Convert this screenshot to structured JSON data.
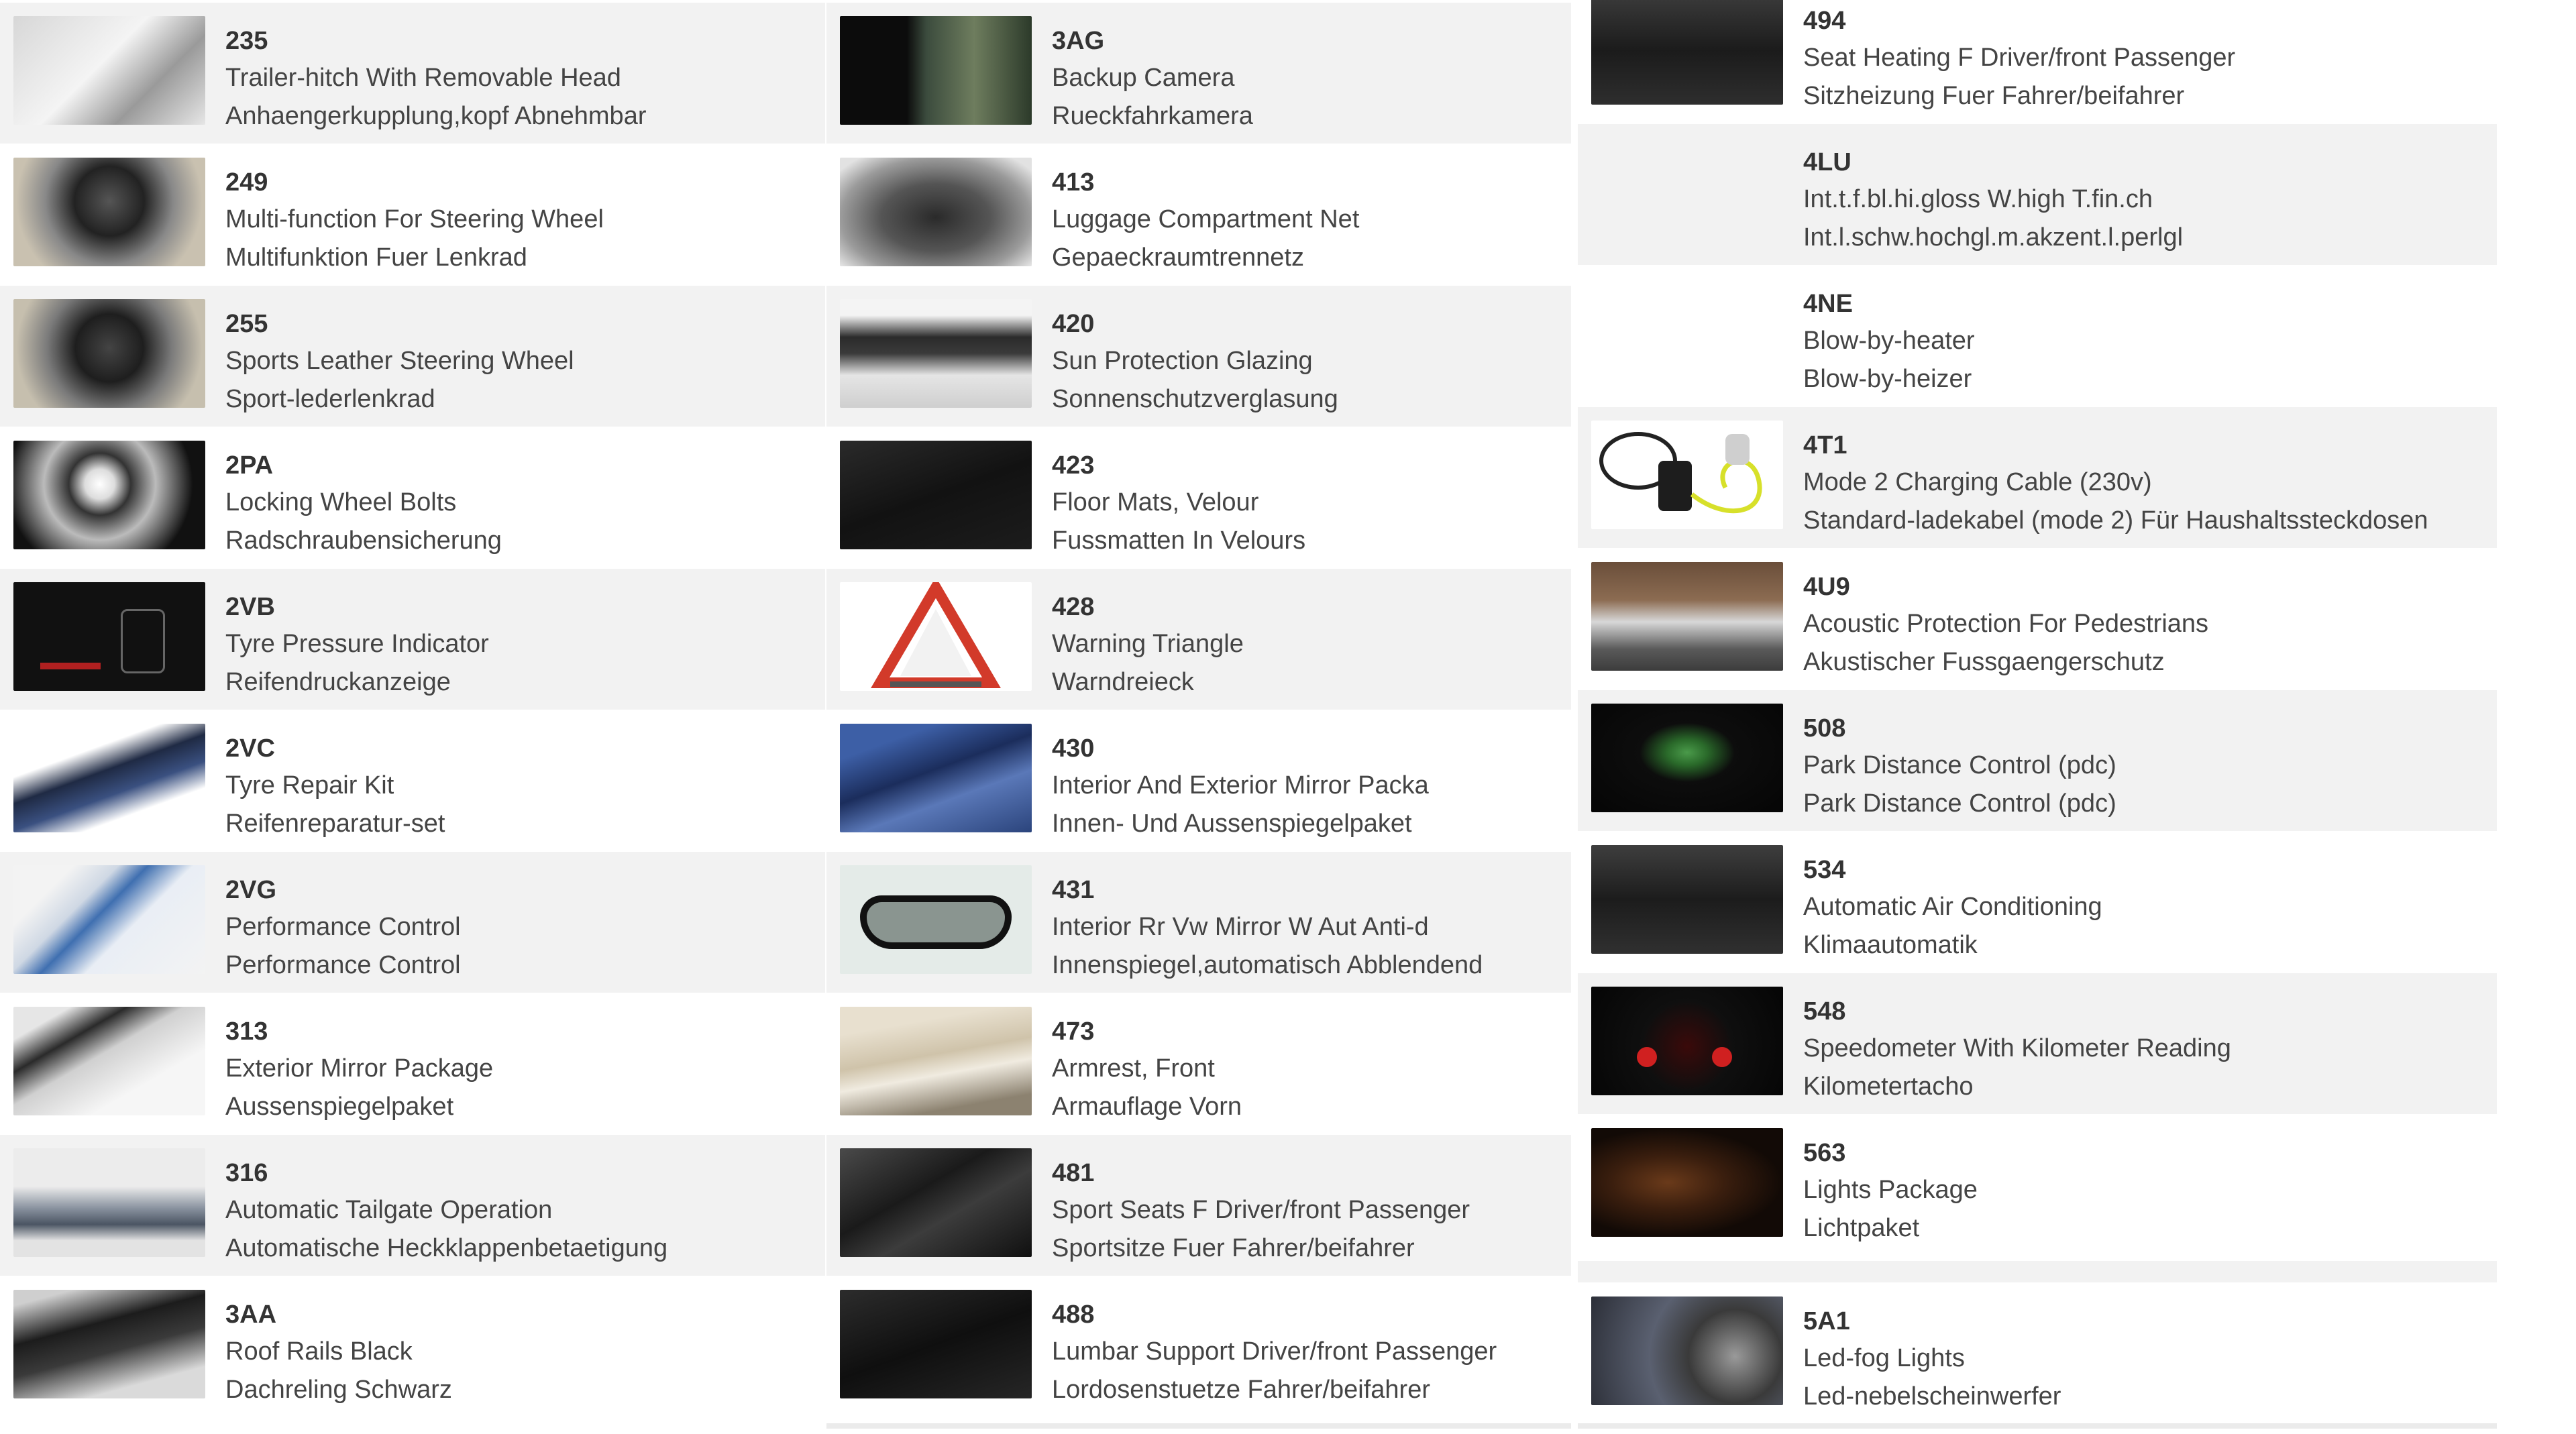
{
  "columns": [
    {
      "items": [
        {
          "code": "235",
          "name_en": "Trailer-hitch With Removable Head",
          "name_de": "Anhaengerkupplung,kopf Abnehmbar",
          "icon": "trailer-hitch-photo"
        },
        {
          "code": "249",
          "name_en": "Multi-function For Steering Wheel",
          "name_de": "Multifunktion Fuer Lenkrad",
          "icon": "steering-wheel-photo"
        },
        {
          "code": "255",
          "name_en": "Sports Leather Steering Wheel",
          "name_de": "Sport-lederlenkrad",
          "icon": "sport-steering-wheel-photo"
        },
        {
          "code": "2PA",
          "name_en": "Locking Wheel Bolts",
          "name_de": "Radschraubensicherung",
          "icon": "wheel-bolts-photo"
        },
        {
          "code": "2VB",
          "name_en": "Tyre Pressure Indicator",
          "name_de": "Reifendruckanzeige",
          "icon": "tyre-pressure-screen-photo"
        },
        {
          "code": "2VC",
          "name_en": "Tyre Repair Kit",
          "name_de": "Reifenreparatur-set",
          "icon": "tyre-repair-kit-photo"
        },
        {
          "code": "2VG",
          "name_en": "Performance Control",
          "name_de": "Performance Control",
          "icon": "performance-control-photo"
        },
        {
          "code": "313",
          "name_en": "Exterior Mirror Package",
          "name_de": "Aussenspiegelpaket",
          "icon": "exterior-mirror-photo"
        },
        {
          "code": "316",
          "name_en": "Automatic Tailgate Operation",
          "name_de": "Automatische Heckklappenbetaetigung",
          "icon": "tailgate-photo"
        },
        {
          "code": "3AA",
          "name_en": "Roof Rails Black",
          "name_de": "Dachreling Schwarz",
          "icon": "roof-rails-photo"
        }
      ]
    },
    {
      "items": [
        {
          "code": "3AG",
          "name_en": "Backup Camera",
          "name_de": "Rueckfahrkamera",
          "icon": "backup-camera-screen-photo"
        },
        {
          "code": "413",
          "name_en": "Luggage Compartment Net",
          "name_de": "Gepaeckraumtrennetz",
          "icon": "luggage-net-photo"
        },
        {
          "code": "420",
          "name_en": "Sun Protection Glazing",
          "name_de": "Sonnenschutzverglasung",
          "icon": "sun-protection-glazing-photo"
        },
        {
          "code": "423",
          "name_en": "Floor Mats, Velour",
          "name_de": "Fussmatten In Velours",
          "icon": "floor-mats-photo"
        },
        {
          "code": "428",
          "name_en": "Warning Triangle",
          "name_de": "Warndreieck",
          "icon": "warning-triangle-photo"
        },
        {
          "code": "430",
          "name_en": "Interior And Exterior Mirror Packa",
          "name_de": "Innen- Und Aussenspiegelpaket",
          "icon": "mirror-package-photo"
        },
        {
          "code": "431",
          "name_en": "Interior Rr Vw Mirror W Aut Anti-d",
          "name_de": "Innenspiegel,automatisch Abblendend",
          "icon": "rear-view-mirror-photo"
        },
        {
          "code": "473",
          "name_en": "Armrest, Front",
          "name_de": "Armauflage Vorn",
          "icon": "armrest-photo"
        },
        {
          "code": "481",
          "name_en": "Sport Seats F Driver/front Passenger",
          "name_de": "Sportsitze Fuer Fahrer/beifahrer",
          "icon": "sport-seats-photo"
        },
        {
          "code": "488",
          "name_en": "Lumbar Support Driver/front Passenger",
          "name_de": "Lordosenstuetze Fahrer/beifahrer",
          "icon": "lumbar-support-photo"
        }
      ]
    },
    {
      "items": [
        {
          "code": "494",
          "name_en": "Seat Heating F Driver/front Passenger",
          "name_de": "Sitzheizung Fuer Fahrer/beifahrer",
          "icon": "seat-heating-panel-photo"
        },
        {
          "code": "4LU",
          "name_en": "Int.t.f.bl.hi.gloss W.high T.fin.ch",
          "name_de": "Int.l.schw.hochgl.m.akzent.l.perlgl",
          "icon": ""
        },
        {
          "code": "4NE",
          "name_en": "Blow-by-heater",
          "name_de": "Blow-by-heizer",
          "icon": ""
        },
        {
          "code": "4T1",
          "name_en": "Mode 2 Charging Cable (230v)",
          "name_de": "Standard-ladekabel (mode 2) Für Haushaltssteckdosen",
          "icon": "charging-cable-photo"
        },
        {
          "code": "4U9",
          "name_en": "Acoustic Protection For Pedestrians",
          "name_de": "Akustischer Fussgaengerschutz",
          "icon": "pedestrian-protection-photo"
        },
        {
          "code": "508",
          "name_en": "Park Distance Control (pdc)",
          "name_de": "Park Distance Control (pdc)",
          "icon": "park-distance-screen-photo"
        },
        {
          "code": "534",
          "name_en": "Automatic Air Conditioning",
          "name_de": "Klimaautomatik",
          "icon": "air-conditioning-panel-photo"
        },
        {
          "code": "548",
          "name_en": "Speedometer With Kilometer Reading",
          "name_de": "Kilometertacho",
          "icon": "speedometer-photo"
        },
        {
          "code": "563",
          "name_en": "Lights Package",
          "name_de": "Lichtpaket",
          "icon": "lights-package-photo"
        },
        {
          "code": "5A1",
          "name_en": "Led-fog Lights",
          "name_de": "Led-nebelscheinwerfer",
          "icon": "fog-lights-photo"
        }
      ]
    }
  ]
}
